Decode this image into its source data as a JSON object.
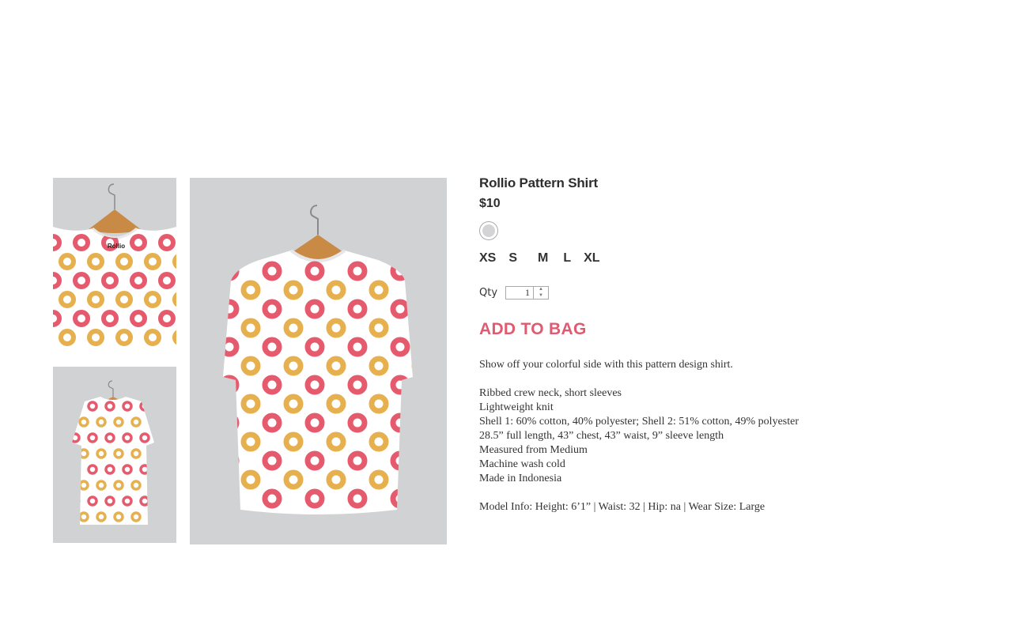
{
  "product": {
    "title": "Rollio Pattern Shirt",
    "price": "$10",
    "thumbnail_brand": "Rollio",
    "swatch_color": "#d4d4d6",
    "sizes": [
      "XS",
      "S",
      "M",
      "L",
      "XL"
    ],
    "qty_label": "Qty",
    "qty_value": "1",
    "add_to_bag": "ADD TO BAG",
    "description_intro": "Show off your colorful side with this pattern design shirt.",
    "features": [
      "Ribbed crew neck, short sleeves",
      "Lightweight knit",
      "Shell 1: 60% cotton, 40% polyester; Shell 2: 51% cotton, 49% polyester",
      "28.5” full length, 43” chest, 43” waist, 9” sleeve length",
      "Measured from Medium",
      "Machine wash cold",
      "Made in Indonesia"
    ],
    "model_info": "Model Info: Height: 6’1” | Waist: 32 | Hip: na | Wear Size: Large"
  },
  "icons": {
    "qty_up": "chevron-up-icon",
    "qty_down": "chevron-down-icon"
  },
  "colors": {
    "accent": "#e05a70",
    "image_background": "#d1d2d4",
    "ring_palette": [
      "#e55a6d",
      "#1f3f7a",
      "#7a4a8a",
      "#e6b04e",
      "#2aa8a8",
      "#c8334b"
    ]
  }
}
